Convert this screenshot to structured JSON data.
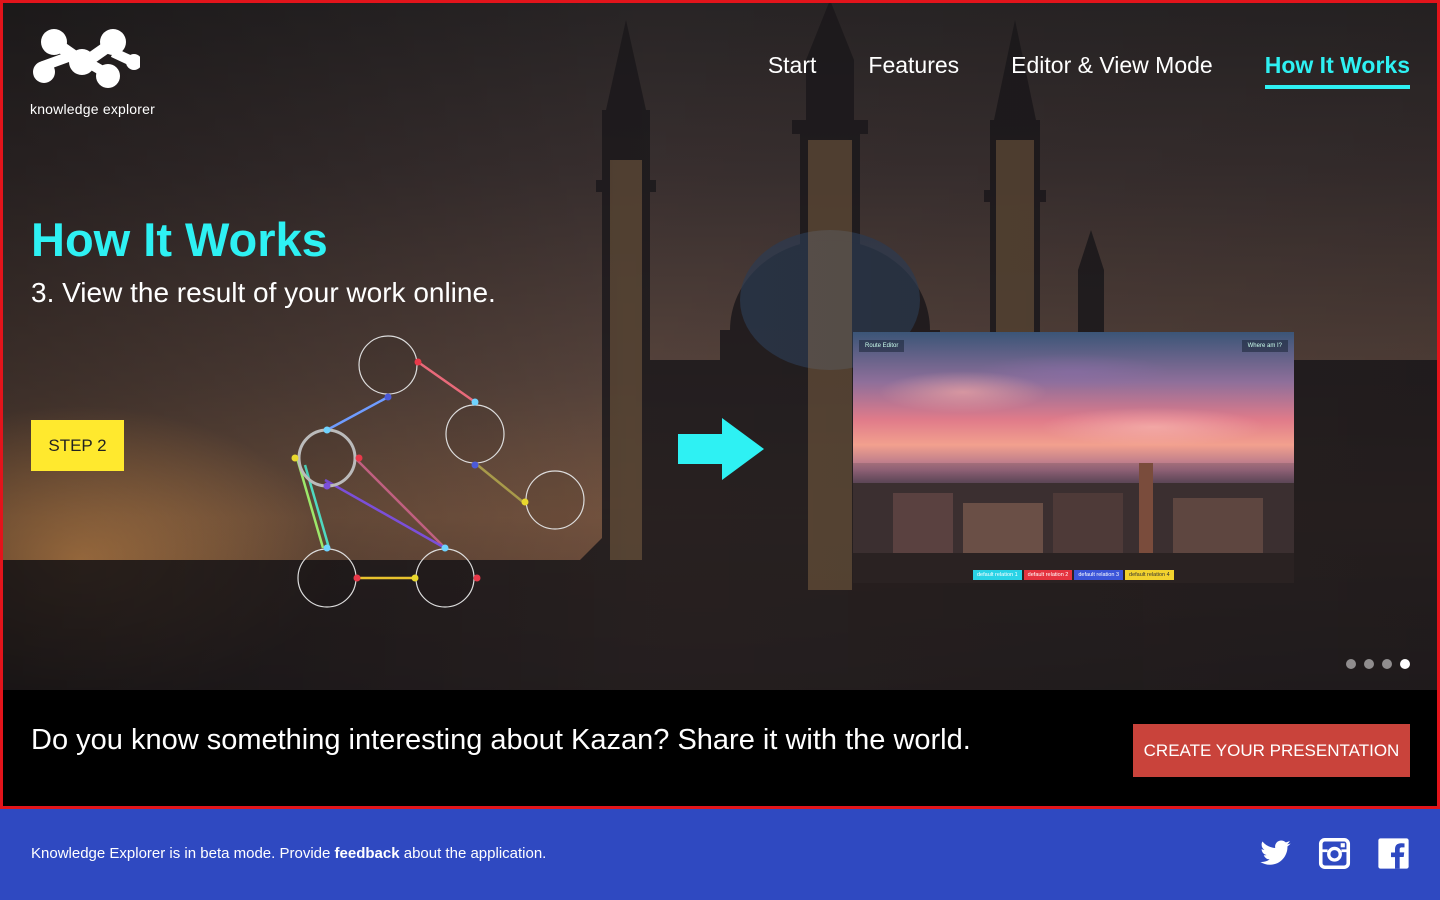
{
  "brand": {
    "name": "knowledge explorer"
  },
  "nav": {
    "items": [
      {
        "label": "Start",
        "active": false
      },
      {
        "label": "Features",
        "active": false
      },
      {
        "label": "Editor & View Mode",
        "active": false
      },
      {
        "label": "How It Works",
        "active": true
      }
    ]
  },
  "hero": {
    "title": "How It Works",
    "subtitle": "3. View the result of your work online.",
    "step_button": "STEP 2",
    "accent_color": "#2ef1f3",
    "step_color": "#ffe92e"
  },
  "preview": {
    "route_editor": "Route Editor",
    "where_am_i": "Where am I?",
    "relations": [
      {
        "label": "default relation 1",
        "color": "#2ad3e6"
      },
      {
        "label": "default relation 2",
        "color": "#e5333f"
      },
      {
        "label": "default relation 3",
        "color": "#3b55d9"
      },
      {
        "label": "default relation 4",
        "color": "#f2d22e"
      }
    ]
  },
  "slider": {
    "total": 4,
    "active_index": 3
  },
  "cta": {
    "text": "Do you know something interesting about Kazan? Share it with the world.",
    "button": "CREATE YOUR PRESENTATION",
    "button_color": "#c9433b"
  },
  "footer": {
    "text_before": "Knowledge Explorer is in beta mode. Provide ",
    "link": "feedback",
    "text_after": " about the application.",
    "background": "#2f49c1",
    "social": [
      "twitter-icon",
      "instagram-icon",
      "facebook-icon"
    ]
  }
}
